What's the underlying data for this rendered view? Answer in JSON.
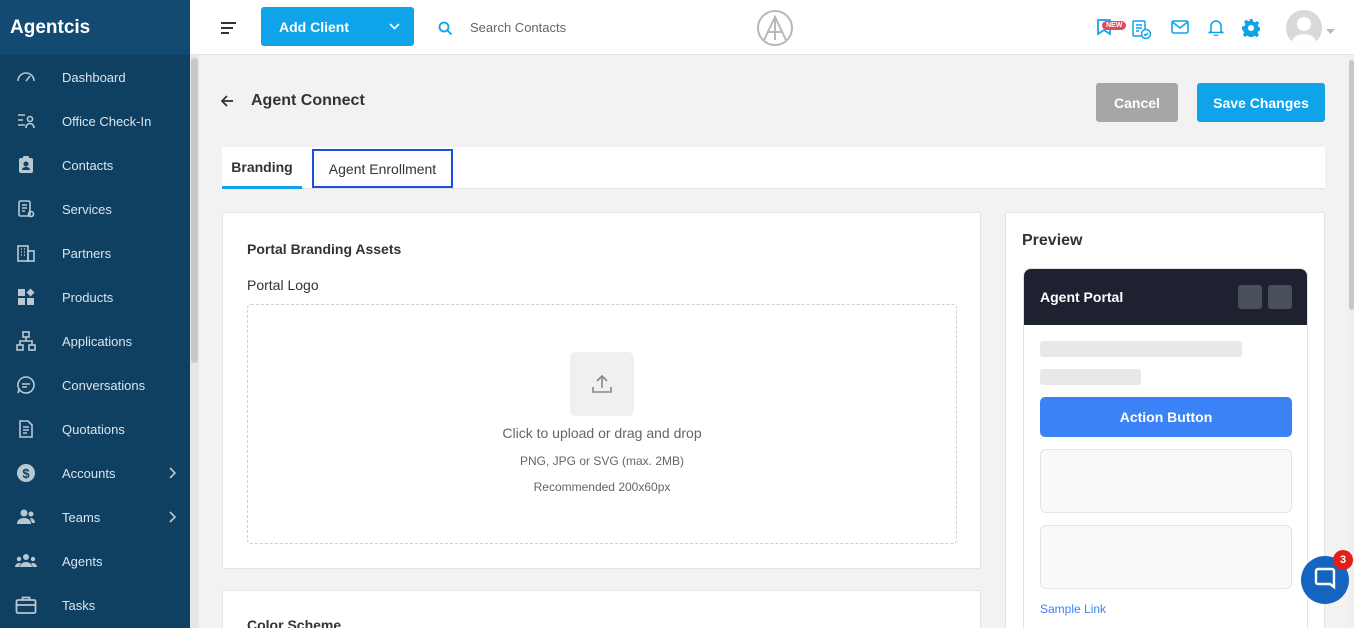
{
  "app": {
    "brand": "Agentcis"
  },
  "sidebar": {
    "items": [
      {
        "label": "Dashboard",
        "icon": "dashboard-gauge-icon"
      },
      {
        "label": "Office Check-In",
        "icon": "office-check-in-icon"
      },
      {
        "label": "Contacts",
        "icon": "contacts-icon"
      },
      {
        "label": "Services",
        "icon": "services-icon"
      },
      {
        "label": "Partners",
        "icon": "partners-building-icon"
      },
      {
        "label": "Products",
        "icon": "products-grid-icon"
      },
      {
        "label": "Applications",
        "icon": "applications-flow-icon"
      },
      {
        "label": "Conversations",
        "icon": "conversations-chat-icon"
      },
      {
        "label": "Quotations",
        "icon": "quotations-document-icon"
      },
      {
        "label": "Accounts",
        "icon": "accounts-dollar-icon",
        "has_submenu": true
      },
      {
        "label": "Teams",
        "icon": "teams-icon",
        "has_submenu": true
      },
      {
        "label": "Agents",
        "icon": "agents-group-icon"
      },
      {
        "label": "Tasks",
        "icon": "tasks-briefcase-icon"
      }
    ]
  },
  "topbar": {
    "add_client_label": "Add Client",
    "search_placeholder": "Search Contacts",
    "new_badge": "NEW",
    "icons": [
      "hamburger-menu-icon",
      "search-icon",
      "agentcis-logo-icon",
      "announcements-icon",
      "checklist-icon",
      "mail-icon",
      "bell-icon",
      "settings-gear-icon",
      "user-avatar-icon"
    ]
  },
  "header": {
    "title": "Agent Connect",
    "cancel_label": "Cancel",
    "save_label": "Save Changes"
  },
  "tabs": [
    {
      "label": "Branding",
      "active": true
    },
    {
      "label": "Agent Enrollment",
      "active": false
    }
  ],
  "branding": {
    "section_title": "Portal Branding Assets",
    "logo_label": "Portal Logo",
    "upload_text": "Click to upload or drag and drop",
    "formats": "PNG, JPG or SVG (max. 2MB)",
    "recommended": "Recommended 200x60px",
    "color_section_title": "Color Scheme"
  },
  "preview": {
    "title": "Preview",
    "portal_title": "Agent Portal",
    "action_button": "Action Button",
    "sample_link": "Sample Link"
  },
  "chat": {
    "unread": "3"
  },
  "colors": {
    "sidebar": "#0f4062",
    "primary": "#0fa3ea",
    "cancel": "#a6a6a6",
    "portal_header": "#1e2130",
    "action": "#3b82f6",
    "badge": "#e0201a"
  }
}
